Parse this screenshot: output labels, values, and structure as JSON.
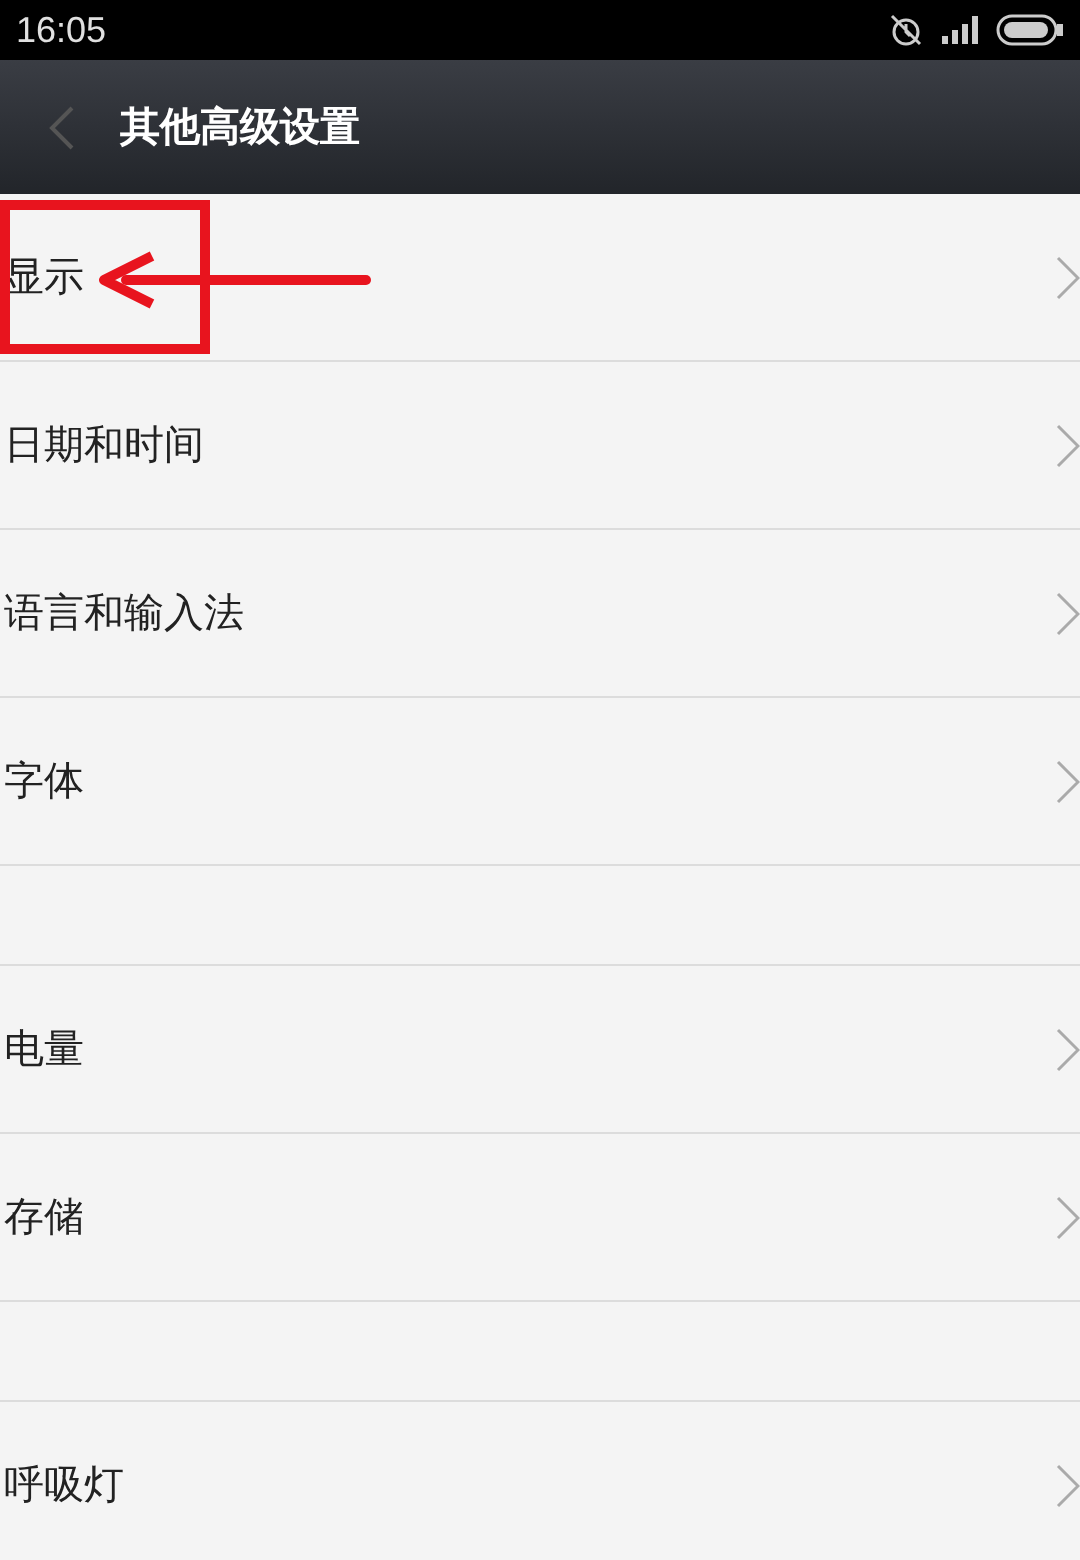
{
  "status_bar": {
    "time": "16:05"
  },
  "header": {
    "title": "其他高级设置"
  },
  "sections": [
    {
      "items": [
        {
          "label": "显示",
          "highlighted": true
        },
        {
          "label": "日期和时间",
          "highlighted": false
        },
        {
          "label": "语言和输入法",
          "highlighted": false
        },
        {
          "label": "字体",
          "highlighted": false
        }
      ]
    },
    {
      "items": [
        {
          "label": "电量",
          "highlighted": false
        },
        {
          "label": "存储",
          "highlighted": false
        }
      ]
    },
    {
      "items": [
        {
          "label": "呼吸灯",
          "highlighted": false
        }
      ]
    }
  ]
}
